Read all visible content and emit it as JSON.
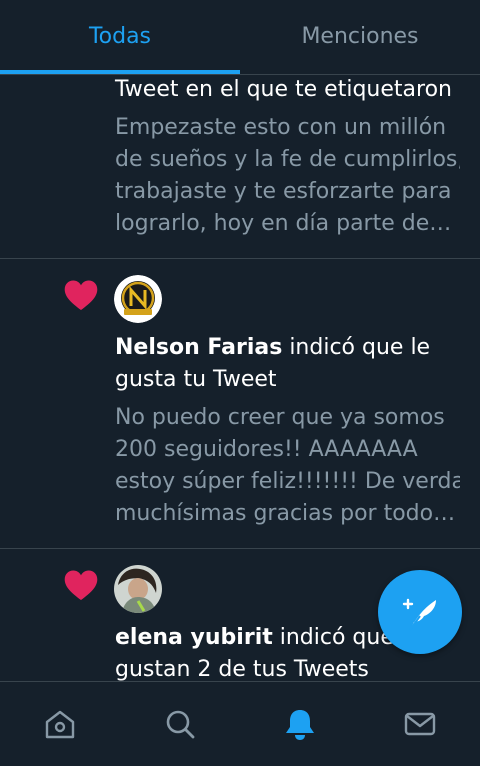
{
  "tabs": {
    "all_label": "Todas",
    "mentions_label": "Menciones"
  },
  "colors": {
    "background": "#15202b",
    "accent": "#1da1f2",
    "heart": "#e0245e",
    "muted_text": "#8899a6",
    "divider": "#38444d"
  },
  "notifications": [
    {
      "title": "Tweet en el que te etiquetaron",
      "body_lines": [
        "Empezaste esto con un millón",
        "de sueños y la fe de cumplirlos,",
        "trabajaste y te esforzarte para",
        "lograrlo, hoy en día parte de…"
      ]
    },
    {
      "icon": "heart-icon",
      "user": "Nelson Farias",
      "action_line1": " indicó que le",
      "action_line2": "gusta tu Tweet",
      "body_lines": [
        "No puedo creer que ya somos",
        "200 seguidores!! AAAAAAA",
        "estoy súper feliz!!!!!!! De verdad",
        "muchísimas gracias por todo…"
      ]
    },
    {
      "icon": "heart-icon",
      "user": "elena  yubirit",
      "action_line1": " indicó que le",
      "action_line2": "gustan 2 de tus Tweets"
    }
  ],
  "fab": {
    "icon": "compose-tweet-icon"
  },
  "bottom_nav": [
    {
      "icon": "home-icon"
    },
    {
      "icon": "search-icon"
    },
    {
      "icon": "notifications-bell-icon",
      "active": true
    },
    {
      "icon": "messages-envelope-icon"
    }
  ]
}
